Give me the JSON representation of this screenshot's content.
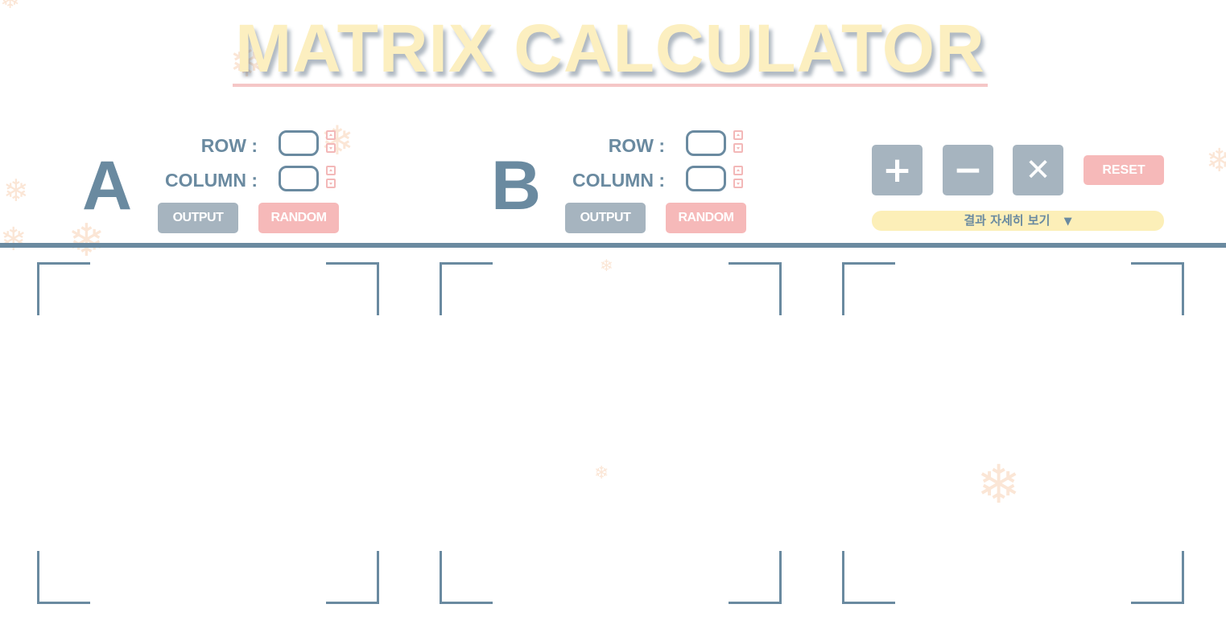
{
  "title": "MATRIX CALCULATOR",
  "matrices": [
    {
      "letter": "A",
      "row_label": "ROW :",
      "column_label": "COLUMN :",
      "row_value": "",
      "column_value": "",
      "output_label": "OUTPUT",
      "random_label": "RANDOM"
    },
    {
      "letter": "B",
      "row_label": "ROW :",
      "column_label": "COLUMN :",
      "row_value": "",
      "column_value": "",
      "output_label": "OUTPUT",
      "random_label": "RANDOM"
    }
  ],
  "operations": {
    "add_symbol": "+",
    "subtract_symbol": "−",
    "multiply_symbol": "✕",
    "reset_label": "RESET",
    "detail_label": "결과 자세히 보기",
    "detail_arrow": "▼"
  },
  "colors": {
    "accent": "#6a8aa0",
    "button_gray": "#a6b4bf",
    "button_pink": "#f6b9b9",
    "title_yellow": "#fcefc0",
    "detail_yellow": "#fcefb8"
  },
  "decorations": {
    "snowflake": "❄"
  }
}
